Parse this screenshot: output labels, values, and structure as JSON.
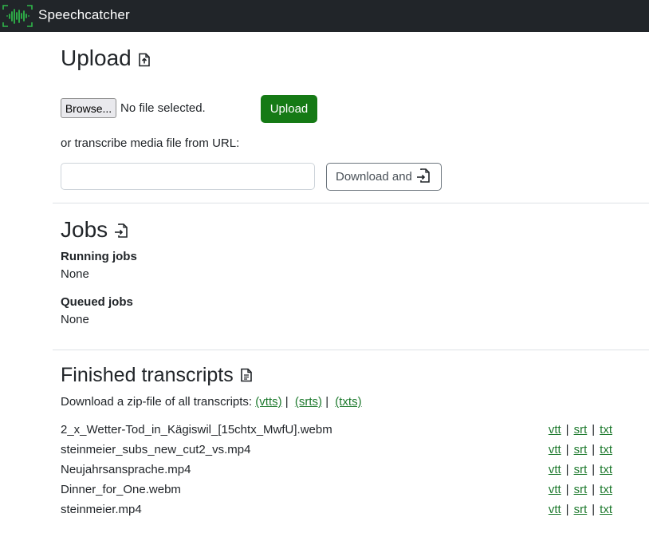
{
  "navbar": {
    "brand": "Speechcatcher",
    "logo_icon": "waveform-logo-icon"
  },
  "upload": {
    "title": "Upload",
    "title_icon": "file-upload-icon",
    "browse_label": "Browse...",
    "file_status": "No file selected.",
    "upload_button": "Upload",
    "url_prompt": "or transcribe media file from URL:",
    "url_value": "",
    "url_placeholder": "",
    "download_button": "Download and",
    "download_icon": "file-import-icon"
  },
  "jobs": {
    "title": "Jobs",
    "title_icon": "file-import-icon",
    "running_label": "Running jobs",
    "running_value": "None",
    "queued_label": "Queued jobs",
    "queued_value": "None"
  },
  "finished": {
    "title": "Finished transcripts",
    "title_icon": "file-text-icon",
    "zip_prompt": "Download a zip-file of all transcripts:",
    "zip_links": [
      "(vtts)",
      "(srts)",
      "(txts)"
    ],
    "separator": "|",
    "items": [
      {
        "name": "2_x_Wetter-Tod_in_Kägiswil_[15chtx_MwfU].webm",
        "vtt": "vtt",
        "srt": "srt",
        "txt": "txt"
      },
      {
        "name": "steinmeier_subs_new_cut2_vs.mp4",
        "vtt": "vtt",
        "srt": "srt",
        "txt": "txt"
      },
      {
        "name": "Neujahrsansprache.mp4",
        "vtt": "vtt",
        "srt": "srt",
        "txt": "txt"
      },
      {
        "name": "Dinner_for_One.webm",
        "vtt": "vtt",
        "srt": "srt",
        "txt": "txt"
      },
      {
        "name": "steinmeier.mp4",
        "vtt": "vtt",
        "srt": "srt",
        "txt": "txt"
      }
    ]
  },
  "colors": {
    "navbar_bg": "#212529",
    "accent_green": "#157a15",
    "link_green": "#1e7a2e",
    "logo_green": "#2fb84a"
  }
}
